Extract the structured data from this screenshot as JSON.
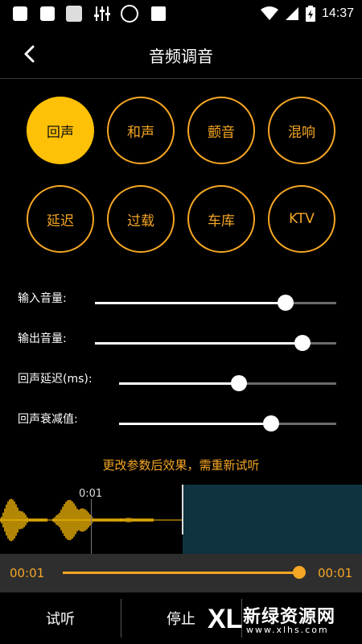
{
  "status_bar": {
    "time": "14:37",
    "icons": [
      "notification-icon",
      "notification-icon",
      "sim-icon",
      "equalizer-icon",
      "dots-icon",
      "square-icon",
      "wifi-icon",
      "signal-icon",
      "battery-charging-icon"
    ]
  },
  "toolbar": {
    "title": "音频调音",
    "back_icon": "back-arrow-icon"
  },
  "effects": {
    "items": [
      "回声",
      "和声",
      "颤音",
      "混响",
      "延迟",
      "过载",
      "车库",
      "KTV"
    ],
    "selected": "回声",
    "accent": "#f5a623",
    "active_fill": "#ffc107"
  },
  "sliders": [
    {
      "label": "输入音量:",
      "value": 0.79
    },
    {
      "label": "输出音量:",
      "value": 0.86
    },
    {
      "label": "回声延迟(ms):",
      "value": 0.55
    },
    {
      "label": "回声衰减值:",
      "value": 0.7
    }
  ],
  "notice": "更改参数后效果，需重新试听",
  "waveform": {
    "time_marker": "0:01"
  },
  "playback": {
    "current_time": "00:01",
    "total_time": "00:01",
    "progress": 1.0
  },
  "buttons": {
    "preview": "试听",
    "stop": "停止"
  },
  "watermark": {
    "logo": "XL",
    "text": "新绿资源网",
    "sub": "www.xlhs.com"
  }
}
